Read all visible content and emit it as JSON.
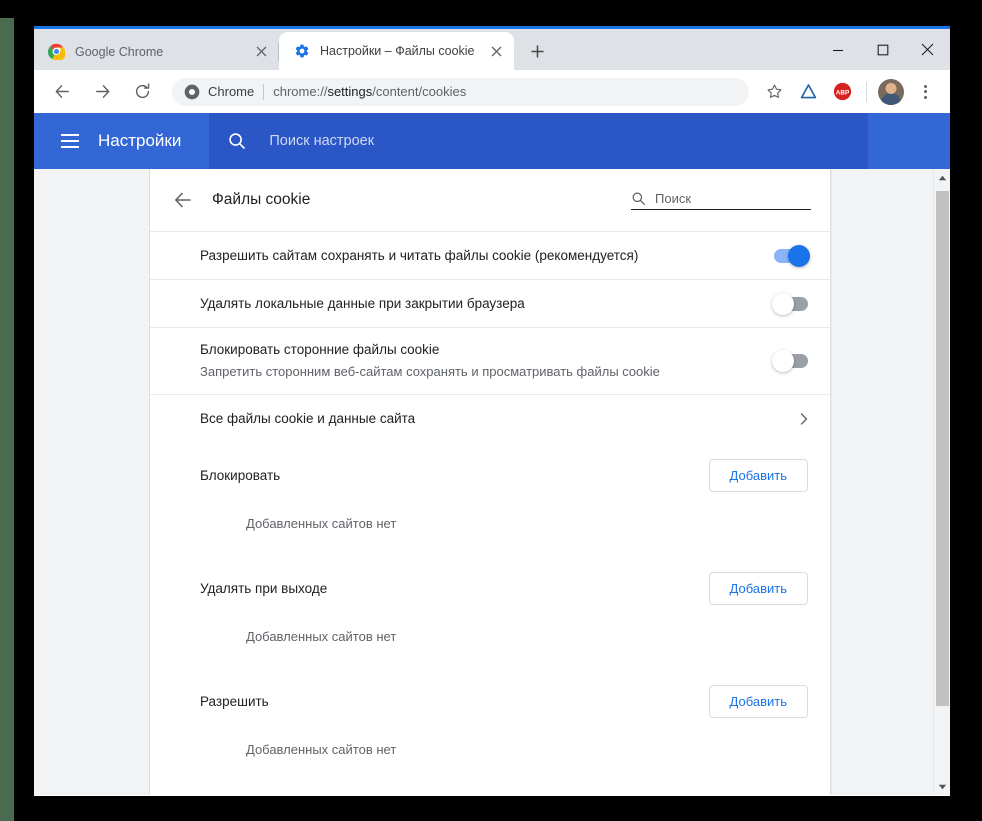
{
  "window": {
    "controls": {
      "minimize_label": "Свернуть",
      "maximize_label": "Развернуть",
      "close_label": "Закрыть"
    }
  },
  "tabs": [
    {
      "title": "Google Chrome",
      "favicon": "chrome-icon",
      "active": false,
      "close_label": "×"
    },
    {
      "title": "Настройки – Файлы cookie",
      "favicon": "gear-icon",
      "active": true,
      "close_label": "×"
    }
  ],
  "newtab": {
    "label": "+",
    "name": "new-tab-button"
  },
  "toolbar": {
    "back_label": "←",
    "forward_label": "→",
    "reload_label": "⟳",
    "omnibox": {
      "chip": "Chrome",
      "url_prefix": "chrome://",
      "url_bold": "settings",
      "url_suffix": "/content/cookies",
      "full_url": "chrome://settings/content/cookies"
    },
    "bookmark_icon": "star-icon",
    "extension_icon": "triangle-extension-icon",
    "adblock_icon": "abp-icon",
    "adblock_label": "ABP",
    "profile_icon": "avatar",
    "menu_icon": "three-dot-menu-icon"
  },
  "settings_header": {
    "menu_icon": "hamburger-icon",
    "title": "Настройки",
    "search_icon": "search-icon",
    "search_placeholder": "Поиск настроек",
    "search_value": ""
  },
  "page": {
    "back_icon": "back-arrow-icon",
    "title": "Файлы cookie",
    "search_icon": "search-icon",
    "search_placeholder": "Поиск",
    "search_value": ""
  },
  "settings_rows": [
    {
      "label": "Разрешить сайтам сохранять и читать файлы cookie (рекомендуется)",
      "sub": "",
      "toggle": "on",
      "name": "allow-cookies-row"
    },
    {
      "label": "Удалять локальные данные при закрытии браузера",
      "sub": "",
      "toggle": "off",
      "name": "clear-on-exit-row"
    },
    {
      "label": "Блокировать сторонние файлы cookie",
      "sub": "Запретить сторонним веб-сайтам сохранять и просматривать файлы cookie",
      "toggle": "off",
      "name": "block-third-party-row"
    }
  ],
  "all_cookies_row": {
    "label": "Все файлы cookie и данные сайта",
    "chevron": "▸",
    "name": "all-cookies-row"
  },
  "sections": [
    {
      "title": "Блокировать",
      "add_label": "Добавить",
      "empty": "Добавленных сайтов нет",
      "name": "block-section"
    },
    {
      "title": "Удалять при выходе",
      "add_label": "Добавить",
      "empty": "Добавленных сайтов нет",
      "name": "clear-on-exit-section"
    },
    {
      "title": "Разрешить",
      "add_label": "Добавить",
      "empty": "Добавленных сайтов нет",
      "name": "allow-section"
    }
  ],
  "scrollbar": {
    "up_label": "▲",
    "down_label": "▼"
  },
  "colors": {
    "accent_blue": "#1a73e8",
    "settings_header": "#3367d6",
    "settings_search": "#2a56c6",
    "toggle_on_track": "#8ab4f8",
    "toggle_off_track": "#9aa0a6",
    "tabstrip": "#dee1e6",
    "page_bg": "#f1f3f4"
  }
}
